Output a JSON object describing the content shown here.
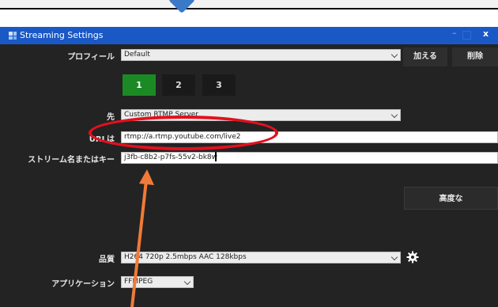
{
  "window": {
    "title": "Streaming Settings"
  },
  "window_buttons": {
    "minimize": "–",
    "close": "x"
  },
  "profile": {
    "label": "プロフィール",
    "value": "Default",
    "add_button": "加える",
    "delete_button": "削除"
  },
  "tabs": [
    {
      "label": "1",
      "active": true
    },
    {
      "label": "2",
      "active": false
    },
    {
      "label": "3",
      "active": false
    }
  ],
  "destination": {
    "label": "先",
    "value": "Custom RTMP Server"
  },
  "url": {
    "label": "URLは",
    "value": "rtmp://a.rtmp.youtube.com/live2"
  },
  "stream_key": {
    "label": "ストリーム名またはキー",
    "value": "j3fb-c8b2-p7fs-55v2-bk8w"
  },
  "advanced_button": "高度な",
  "quality": {
    "label": "品質",
    "value": "H264 720p 2.5mbps AAC 128kbps"
  },
  "application": {
    "label": "アプリケーション",
    "value": "FFMPEG"
  },
  "colors": {
    "titlebar": "#1a58c6",
    "panel": "#232323",
    "active_tab": "#1b8a24",
    "highlight": "#e3101e",
    "arrow": "#f07a37",
    "diamond": "#3a78c8"
  },
  "icons": [
    "windows-app-icon",
    "gear-icon",
    "chevron-down-icon"
  ]
}
